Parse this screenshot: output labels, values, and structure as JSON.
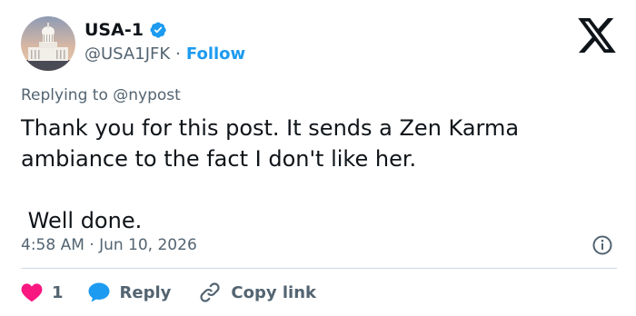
{
  "author": {
    "display_name": "USA-1",
    "handle": "@USA1JFK",
    "separator": "·",
    "follow_label": "Follow",
    "verified_color": "#1d9bf0"
  },
  "reply_to": {
    "prefix": "Replying to",
    "mention": "@nypost"
  },
  "tweet": {
    "text": "Thank you for this post. It sends a Zen Karma ambiance to the fact I don't like her.\n\n Well done.",
    "timestamp": "4:58 AM · Jun 10, 2026"
  },
  "actions": {
    "like_count": "1",
    "reply_label": "Reply",
    "copy_link_label": "Copy link"
  },
  "icons": {
    "brand": "x-logo-icon",
    "verified": "verified-badge-icon",
    "info": "info-icon",
    "like": "heart-icon",
    "reply": "speech-bubble-icon",
    "copy": "link-icon"
  },
  "colors": {
    "text": "#0f1419",
    "secondary": "#536471",
    "accent": "#1d9bf0",
    "like": "#f91880",
    "divider": "#cfd9de"
  }
}
